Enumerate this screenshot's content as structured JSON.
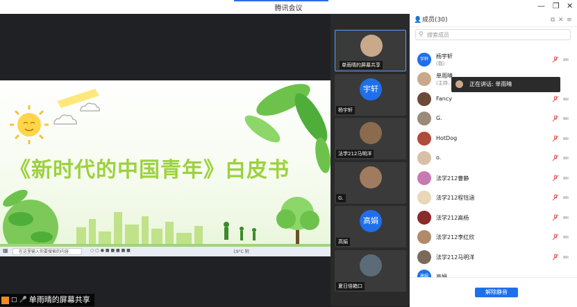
{
  "window": {
    "title": "腾讯会议"
  },
  "slide": {
    "title": "《新时代的中国青年》白皮书",
    "taskbar_search": "在这里输入你要搜索的内容",
    "taskbar_temp": "19°C 阴"
  },
  "share_label": "单雨晴的屏幕共享",
  "tiles": [
    {
      "name": "单雨晴的屏幕共享",
      "avatar_text": ""
    },
    {
      "name": "杨宇轩",
      "avatar_text": "宇轩"
    },
    {
      "name": "法学212马明洋",
      "avatar_text": ""
    },
    {
      "name": "G.",
      "avatar_text": ""
    },
    {
      "name": "高娟",
      "avatar_text": "高娟"
    },
    {
      "name": "夏日倍箱口",
      "avatar_text": ""
    }
  ],
  "panel": {
    "header": "成员(30)",
    "search_placeholder": "搜索成员",
    "unmute_button": "解除静音",
    "members": [
      {
        "name": "杨宇轩",
        "sub": "(我)",
        "avatar_text": "宇轩"
      },
      {
        "name": "单雨晴",
        "sub": "(主持...",
        "avatar_text": ""
      },
      {
        "name": "Fancy",
        "sub": "",
        "avatar_text": ""
      },
      {
        "name": "G.",
        "sub": "",
        "avatar_text": ""
      },
      {
        "name": "HotDog",
        "sub": "",
        "avatar_text": ""
      },
      {
        "name": "o.",
        "sub": "",
        "avatar_text": ""
      },
      {
        "name": "法学212曹静",
        "sub": "",
        "avatar_text": ""
      },
      {
        "name": "法学212程钰涵",
        "sub": "",
        "avatar_text": ""
      },
      {
        "name": "法学212高杨",
        "sub": "",
        "avatar_text": ""
      },
      {
        "name": "法学212李红欣",
        "sub": "",
        "avatar_text": ""
      },
      {
        "name": "法学212马明洋",
        "sub": "",
        "avatar_text": ""
      },
      {
        "name": "高娟",
        "sub": "",
        "avatar_text": "高娟"
      }
    ]
  },
  "tooltip": {
    "text": "正在讲话: 单雨晴"
  },
  "colors": {
    "accent": "#1f6feb",
    "slide_title": "#9bd23c",
    "mic_muted": "#e05252"
  }
}
